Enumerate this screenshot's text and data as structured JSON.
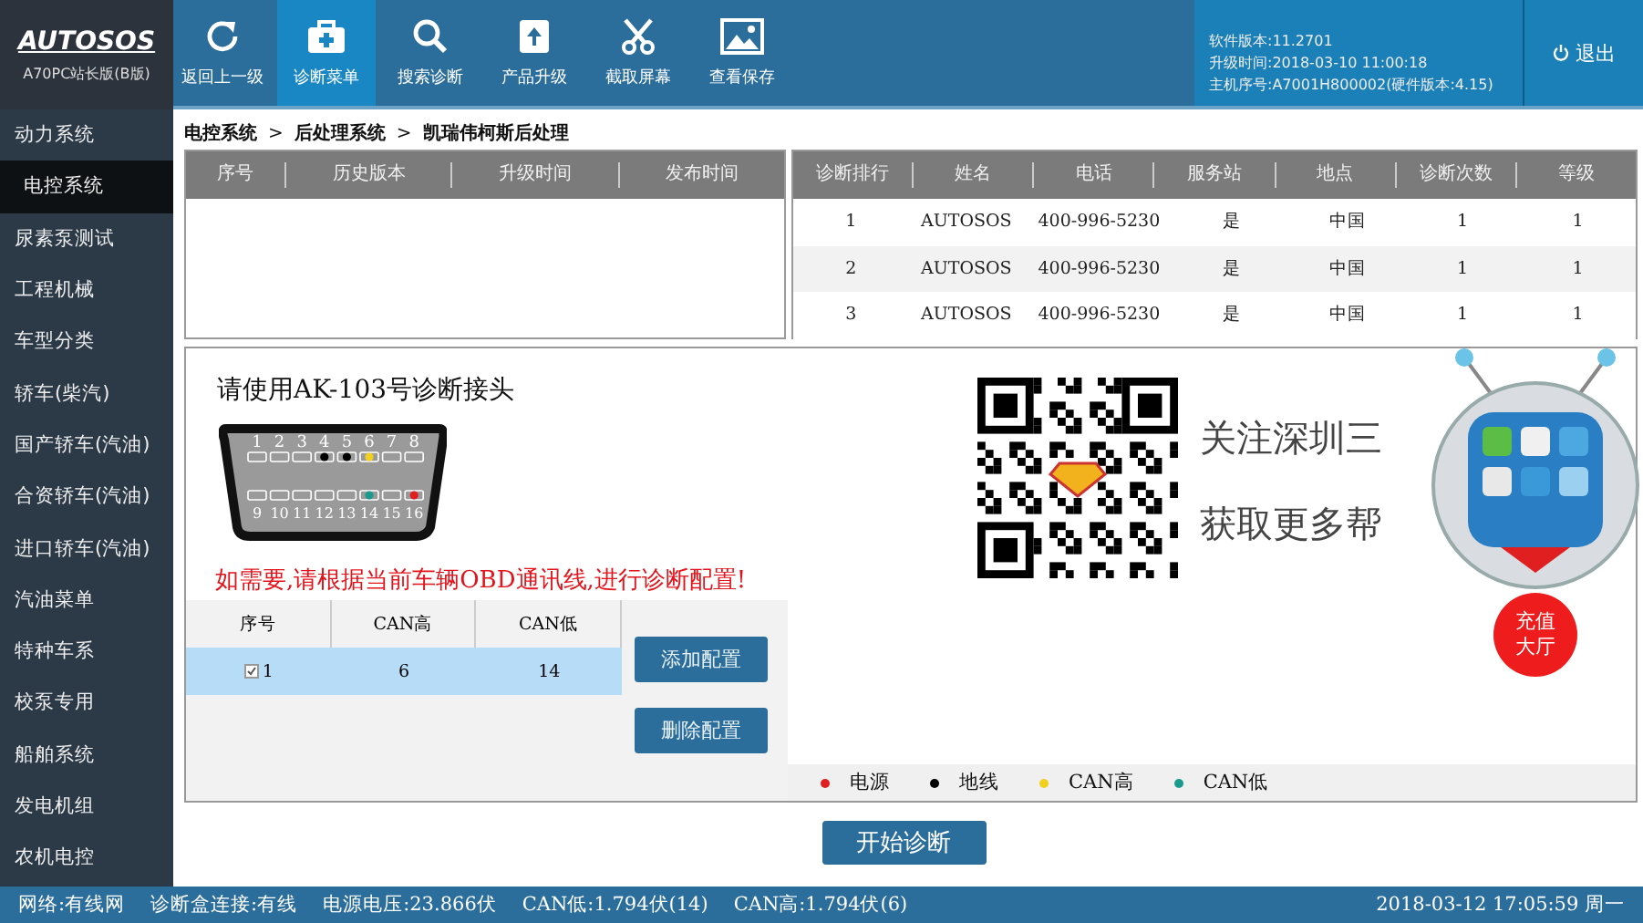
{
  "logo": {
    "brand": "AUTOSOS",
    "model": "A70PC站长版(B版)"
  },
  "toolbar": [
    {
      "label": "返回上一级",
      "selected": false
    },
    {
      "label": "诊断菜单",
      "selected": true
    },
    {
      "label": "搜索诊断",
      "selected": false
    },
    {
      "label": "产品升级",
      "selected": false
    },
    {
      "label": "截取屏幕",
      "selected": false
    },
    {
      "label": "查看保存",
      "selected": false
    }
  ],
  "info": [
    "软件版本:11.2701",
    "升级时间:2018-03-10 11:00:18",
    "主机序号:A7001H800002(硬件版本:4.15)"
  ],
  "logout": "退出",
  "sidebar": [
    {
      "label": "动力系统",
      "selected": false
    },
    {
      "label": "电控系统",
      "selected": true
    },
    {
      "label": "尿素泵测试",
      "selected": false
    },
    {
      "label": "工程机械",
      "selected": false
    },
    {
      "label": "车型分类",
      "selected": false
    },
    {
      "label": "轿车(柴汽)",
      "selected": false
    },
    {
      "label": "国产轿车(汽油)",
      "selected": false
    },
    {
      "label": "合资轿车(汽油)",
      "selected": false
    },
    {
      "label": "进口轿车(汽油)",
      "selected": false
    },
    {
      "label": "汽油菜单",
      "selected": false
    },
    {
      "label": "特种车系",
      "selected": false
    },
    {
      "label": "校泵专用",
      "selected": false
    },
    {
      "label": "船舶系统",
      "selected": false
    },
    {
      "label": "发电机组",
      "selected": false
    },
    {
      "label": "农机电控",
      "selected": false
    }
  ],
  "breadcrumb": [
    "电控系统",
    ">",
    "后处理系统",
    ">",
    "凯瑞伟柯斯后处理"
  ],
  "history_table": {
    "columns": [
      "序号",
      "历史版本",
      "升级时间",
      "发布时间"
    ]
  },
  "ranking_table": {
    "columns": [
      "诊断排行",
      "姓名",
      "电话",
      "服务站",
      "地点",
      "诊断次数",
      "等级"
    ],
    "rows": [
      [
        "1",
        "AUTOSOS",
        "400-996-5230",
        "是",
        "中国",
        "1",
        "1"
      ],
      [
        "2",
        "AUTOSOS",
        "400-996-5230",
        "是",
        "中国",
        "1",
        "1"
      ],
      [
        "3",
        "AUTOSOS",
        "400-996-5230",
        "是",
        "中国",
        "1",
        "1"
      ]
    ]
  },
  "connector_title": "请使用AK-103号诊断接头",
  "pins_top": [
    {
      "label": "1"
    },
    {
      "label": "2"
    },
    {
      "label": "3"
    },
    {
      "label": "4",
      "color": "#000000"
    },
    {
      "label": "5",
      "color": "#000000"
    },
    {
      "label": "6",
      "color": "#f2d01e"
    },
    {
      "label": "7"
    },
    {
      "label": "8"
    }
  ],
  "pins_bottom": [
    {
      "label": "9"
    },
    {
      "label": "10"
    },
    {
      "label": "11"
    },
    {
      "label": "12"
    },
    {
      "label": "13"
    },
    {
      "label": "14",
      "color": "#1a9a8c"
    },
    {
      "label": "15"
    },
    {
      "label": "16",
      "color": "#e02020"
    }
  ],
  "warning": "如需要,请根据当前车辆OBD通讯线,进行诊断配置!",
  "config_table": {
    "columns": [
      "序号",
      "CAN高",
      "CAN低"
    ],
    "rows": [
      {
        "cells": [
          "1",
          "6",
          "14"
        ],
        "checked": true,
        "selected": true
      }
    ]
  },
  "config_buttons": [
    "添加配置",
    "删除配置"
  ],
  "promo": [
    "关注深圳三",
    "获取更多帮"
  ],
  "recharge": [
    "充值",
    "大厅"
  ],
  "legend": [
    {
      "label": "电源",
      "color": "#e02020"
    },
    {
      "label": "地线",
      "color": "#000000"
    },
    {
      "label": "CAN高",
      "color": "#f2d01e"
    },
    {
      "label": "CAN低",
      "color": "#1a9a8c"
    }
  ],
  "start_button": "开始诊断",
  "status_bar": {
    "left": [
      "网络:有线网",
      "诊断盒连接:有线",
      "电源电压:23.866伏",
      "CAN低:1.794伏(14)",
      "CAN高:1.794伏(6)"
    ],
    "right": "2018-03-12 17:05:59 周一"
  }
}
